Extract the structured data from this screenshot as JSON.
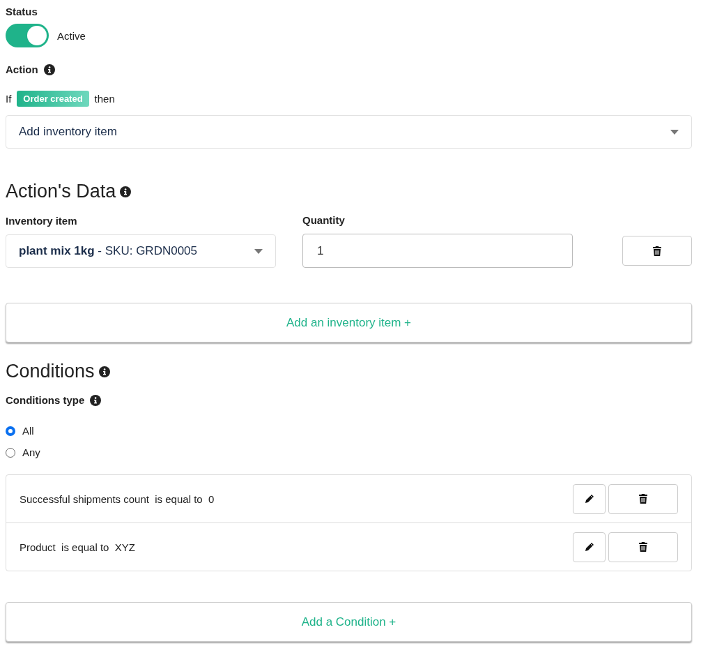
{
  "status": {
    "label": "Status",
    "on": true,
    "text": "Active"
  },
  "action": {
    "label": "Action",
    "prefix": "If",
    "trigger": "Order created",
    "suffix": "then",
    "select_value": "Add inventory item"
  },
  "actions_data": {
    "title": "Action's Data",
    "inventory_label": "Inventory item",
    "item_name": "plant mix 1kg",
    "item_sku": " - SKU: GRDN0005",
    "quantity_label": "Quantity",
    "quantity": "1",
    "add_button": "Add an inventory item +"
  },
  "conditions": {
    "title": "Conditions",
    "type_label": "Conditions type",
    "types": [
      {
        "label": "All",
        "selected": true
      },
      {
        "label": "Any",
        "selected": false
      }
    ],
    "rows": [
      {
        "field": "Successful shipments count",
        "operator": "is equal to",
        "value": "0"
      },
      {
        "field": "Product",
        "operator": "is equal to",
        "value": "XYZ"
      }
    ],
    "add_button": "Add a Condition +"
  }
}
